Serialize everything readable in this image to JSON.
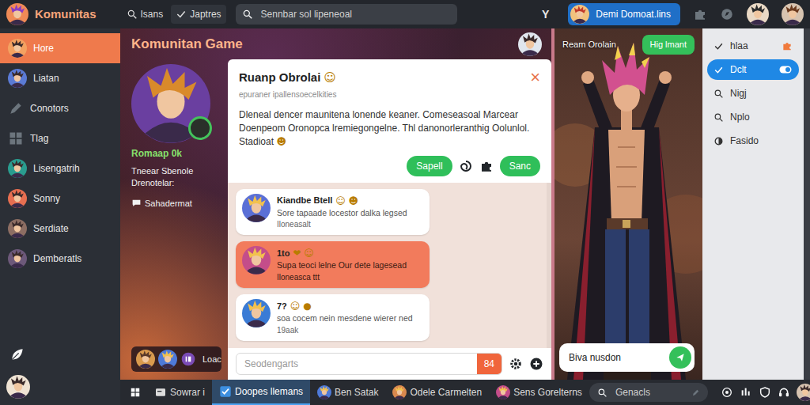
{
  "topbar": {
    "brand": "Komunitas",
    "links": [
      "Isans",
      "Japtres"
    ],
    "search": {
      "placeholder": "Sennbar sol lipeneoal"
    },
    "filter": "Y",
    "account": "Demi Domoat.lins"
  },
  "sidebar": {
    "items": [
      {
        "label": "Hore",
        "selected": true
      },
      {
        "label": "Liatan",
        "selected": false
      },
      {
        "label": "Conotors",
        "selected": false
      },
      {
        "label": "Tlag",
        "selected": false
      },
      {
        "label": "Lisengatrih",
        "selected": false
      },
      {
        "label": "Sonny",
        "selected": false
      },
      {
        "label": "Serdiate",
        "selected": false
      },
      {
        "label": "Demberatls",
        "selected": false
      }
    ]
  },
  "community": {
    "title": "Komunitan Game",
    "profile": {
      "name": "Romaap 0k",
      "description": "Tneear Sbenole Drenotelar:",
      "link": "Sahadermat"
    },
    "gallery": {
      "label": "Loac"
    }
  },
  "chat_dialog": {
    "title": "Ruanp Obrolai",
    "title_emoji": "☺",
    "subtitle": "epuraner ipallensoecelkities",
    "close": "×",
    "body": "Dleneal dencer maunitena lonende keaner. Comeseasoal Marcear Doenpeom Oronopca lremiegongelne. Thl danonorleranthig Oolunlol. Stadioat",
    "body_emoji": "☻",
    "buttons": [
      "Sapell",
      "Sanc"
    ],
    "messages": [
      {
        "author": "Kiandbe Btell",
        "emoji": "☺ ☻",
        "text": "Sore tapaade locestor dalka legsed",
        "meta": "Iloneasalt",
        "selected": false
      },
      {
        "author": "1to",
        "emoji": "❤ ☺",
        "text": "Supa teoci lelne Our dete lagesead",
        "meta": "Iloneasca ttt",
        "selected": true
      },
      {
        "author": "7?",
        "emoji": "☺ ●",
        "text": "soa cocem nein mesdene wierer ned",
        "meta": "19aak",
        "selected": false
      }
    ],
    "composer": {
      "placeholder": "Seodengarts",
      "badge": "84"
    }
  },
  "stream": {
    "title": "Ream Orolain",
    "button": "Hig lmant",
    "input": "Biva nusdon"
  },
  "side_menu": {
    "items": [
      {
        "label": "hlaa",
        "selected": false
      },
      {
        "label": "Dclt",
        "selected": true
      },
      {
        "label": "Nigj",
        "selected": false
      },
      {
        "label": "Nplo",
        "selected": false
      },
      {
        "label": "Fasido",
        "selected": false
      }
    ]
  },
  "taskbar": {
    "items": [
      {
        "label": "Sowrar i",
        "selected": false
      },
      {
        "label": "Doopes llemans",
        "selected": true
      },
      {
        "label": "Ben Satak",
        "selected": false
      },
      {
        "label": "Odele Carmelten",
        "selected": false
      },
      {
        "label": "Sens Gorelterns",
        "selected": false
      }
    ],
    "search": {
      "placeholder": "Genacls"
    }
  }
}
